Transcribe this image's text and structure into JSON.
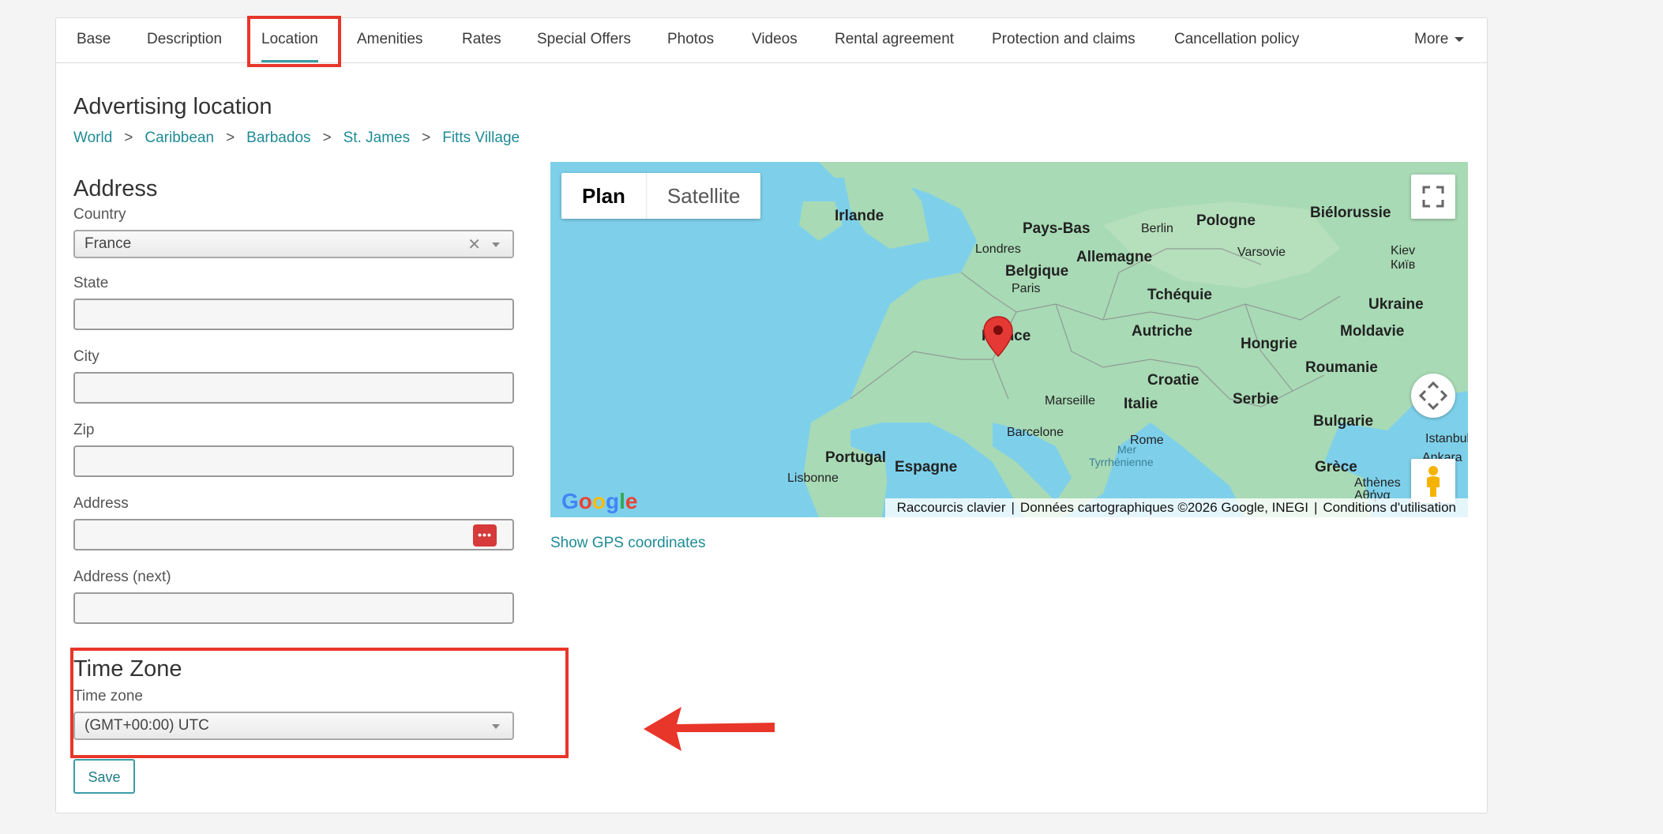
{
  "tabs": [
    {
      "label": "Base"
    },
    {
      "label": "Description"
    },
    {
      "label": "Location",
      "active": true
    },
    {
      "label": "Amenities"
    },
    {
      "label": "Rates"
    },
    {
      "label": "Special Offers"
    },
    {
      "label": "Photos"
    },
    {
      "label": "Videos"
    },
    {
      "label": "Rental agreement"
    },
    {
      "label": "Protection and claims"
    },
    {
      "label": "Cancellation policy"
    }
  ],
  "more_label": "More",
  "advertising": {
    "title": "Advertising location",
    "breadcrumb": [
      "World",
      "Caribbean",
      "Barbados",
      "St. James",
      "Fitts Village"
    ],
    "separator": ">"
  },
  "address_section": {
    "title": "Address",
    "country_label": "Country",
    "country_value": "France",
    "state_label": "State",
    "city_label": "City",
    "zip_label": "Zip",
    "address_label": "Address",
    "address_next_label": "Address (next)"
  },
  "timezone": {
    "title": "Time Zone",
    "label": "Time zone",
    "value": "(GMT+00:00) UTC"
  },
  "save_label": "Save",
  "map": {
    "map_type_plan": "Plan",
    "map_type_satellite": "Satellite",
    "countries": [
      "Irlande",
      "Pays-Bas",
      "Berlin",
      "Pologne",
      "Biélorussie",
      "Londres",
      "Belgique",
      "Allemagne",
      "Varsovie",
      "Kiev",
      "Київ",
      "Paris",
      "Tchéquie",
      "Ukraine",
      "France",
      "Autriche",
      "Hongrie",
      "Moldavie",
      "Roumanie",
      "Croatie",
      "Marseille",
      "Italie",
      "Serbie",
      "Portugal",
      "Barcelone",
      "Rome",
      "Bulgarie",
      "Istanbul",
      "Espagne",
      "Mer",
      "Tyrrhénienne",
      "Ankara",
      "Lisbonne",
      "Grèce",
      "Athènes",
      "Αθήνα"
    ],
    "google_logo": "Google",
    "attribution": {
      "shortcuts": "Raccourcis clavier",
      "data": "Données cartographiques ©2026 Google, INEGI",
      "terms": "Conditions d'utilisation"
    }
  },
  "show_gps_label": "Show GPS coordinates",
  "colors": {
    "accent": "#1f8b95",
    "highlight": "#e8362a",
    "marker": "#e53935",
    "water": "#7ed0ea",
    "land": "#a8dab5"
  }
}
